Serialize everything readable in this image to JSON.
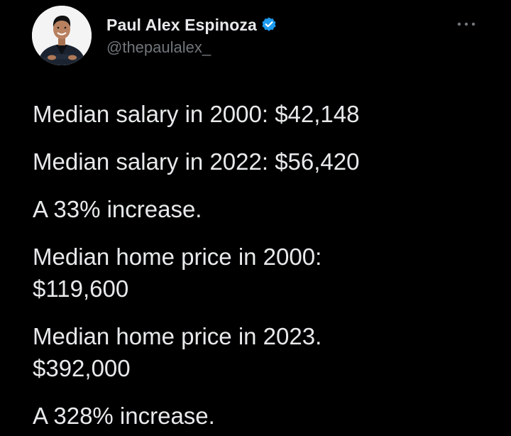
{
  "author": {
    "display_name": "Paul Alex Espinoza",
    "handle": "@thepaulalex_",
    "verified": true,
    "verified_color": "#1d9bf0"
  },
  "icons": {
    "verified": "verified-badge-icon",
    "more": "more-options-icon",
    "avatar": "profile-photo"
  },
  "tweet": {
    "lines": [
      "Median salary in 2000: $42,148",
      "Median salary in 2022: $56,420",
      "A 33% increase.",
      "Median home price in 2000:",
      "$119,600",
      "Median home price in 2023.",
      "$392,000",
      "A 328% increase."
    ]
  },
  "colors": {
    "background": "#000000",
    "text": "#e7e9ea",
    "secondary_text": "#71767b"
  }
}
